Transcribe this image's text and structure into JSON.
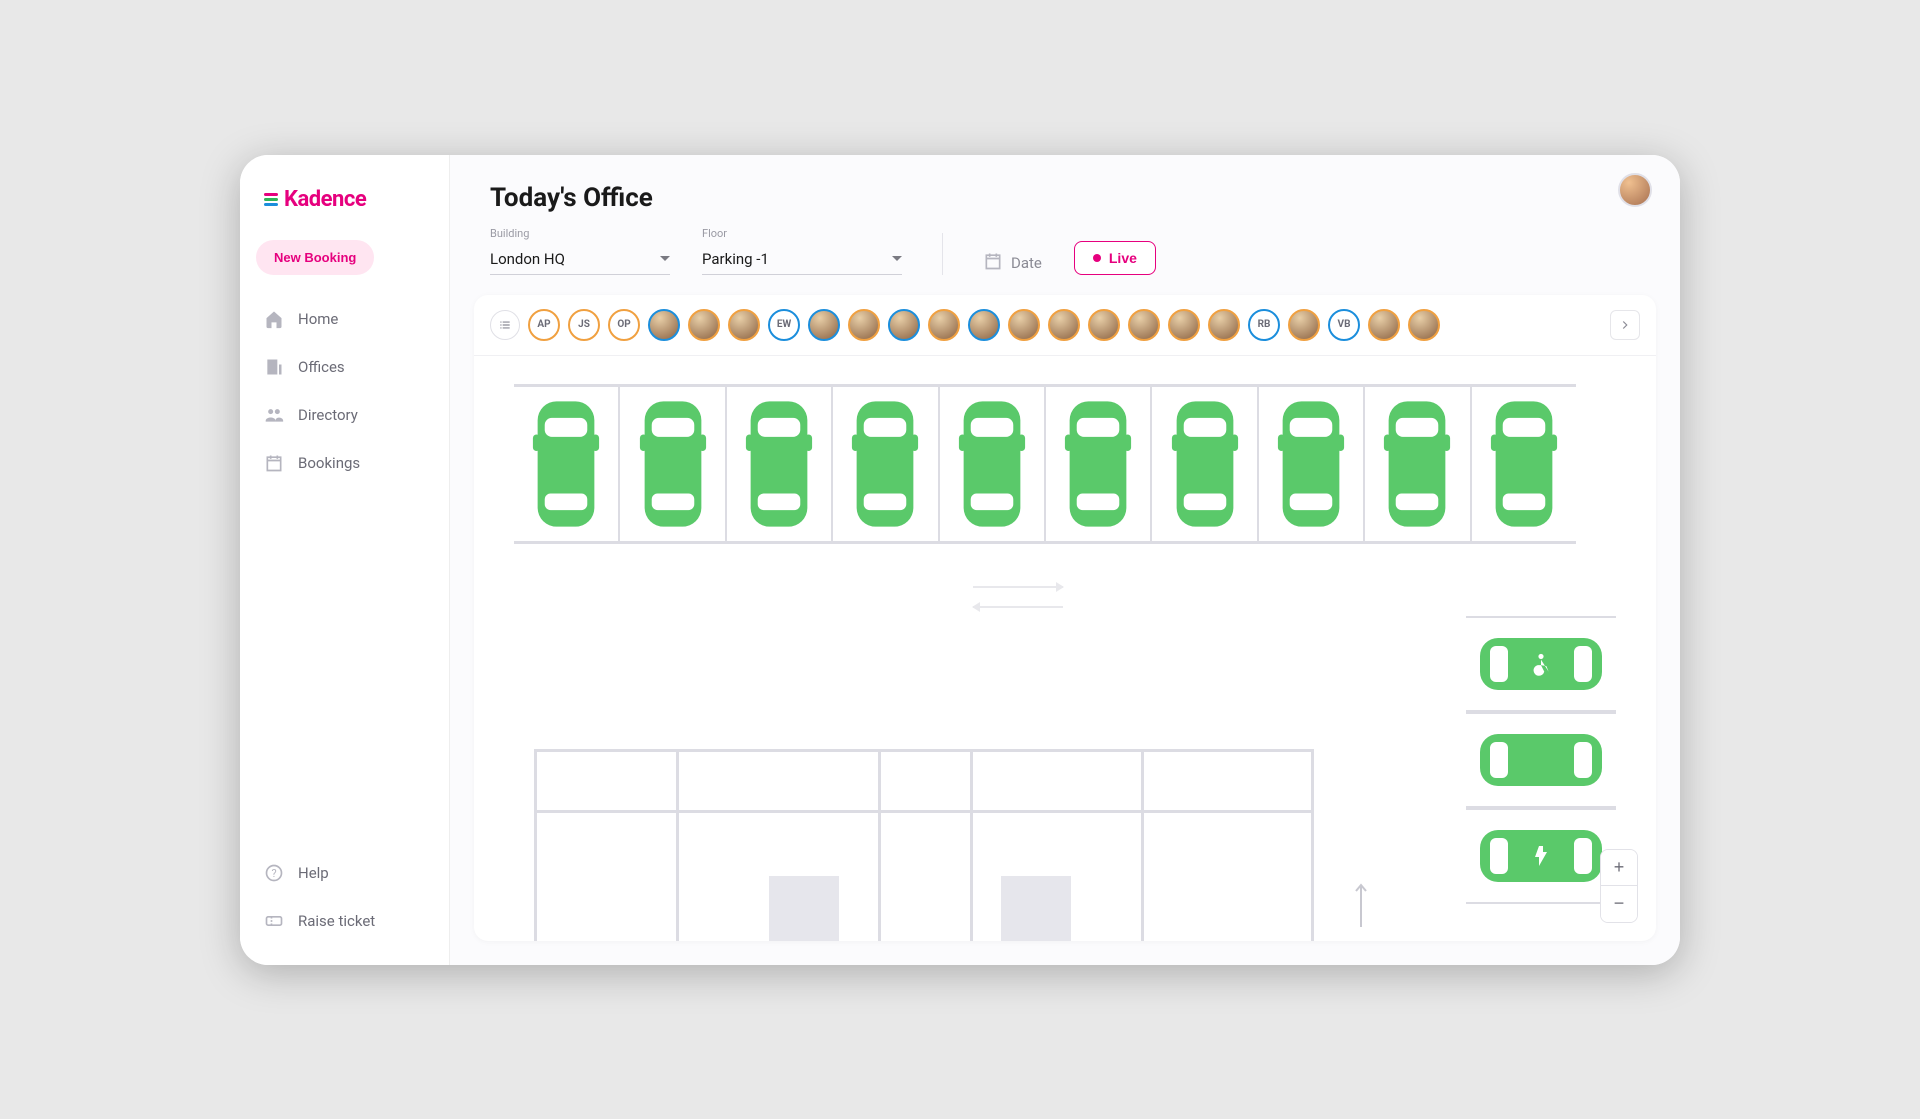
{
  "brand": {
    "name": "Kadence"
  },
  "sidebar": {
    "new_booking_label": "New Booking",
    "items": [
      {
        "label": "Home"
      },
      {
        "label": "Offices"
      },
      {
        "label": "Directory"
      },
      {
        "label": "Bookings"
      }
    ],
    "bottom": [
      {
        "label": "Help"
      },
      {
        "label": "Raise ticket"
      }
    ]
  },
  "header": {
    "title": "Today's Office",
    "building_label": "Building",
    "building_value": "London HQ",
    "floor_label": "Floor",
    "floor_value": "Parking -1",
    "date_label": "Date",
    "live_label": "Live"
  },
  "people_strip": {
    "users": [
      {
        "initials": "AP",
        "ring": "orange",
        "photo": false
      },
      {
        "initials": "JS",
        "ring": "orange",
        "photo": false
      },
      {
        "initials": "OP",
        "ring": "orange",
        "photo": false
      },
      {
        "initials": "",
        "ring": "blue",
        "photo": true
      },
      {
        "initials": "",
        "ring": "orange",
        "photo": true
      },
      {
        "initials": "",
        "ring": "orange",
        "photo": true
      },
      {
        "initials": "EW",
        "ring": "blue",
        "photo": false
      },
      {
        "initials": "",
        "ring": "blue",
        "photo": true
      },
      {
        "initials": "",
        "ring": "orange",
        "photo": true
      },
      {
        "initials": "",
        "ring": "blue",
        "photo": true
      },
      {
        "initials": "",
        "ring": "orange",
        "photo": true
      },
      {
        "initials": "",
        "ring": "blue",
        "photo": true
      },
      {
        "initials": "",
        "ring": "orange",
        "photo": true
      },
      {
        "initials": "",
        "ring": "orange",
        "photo": true
      },
      {
        "initials": "",
        "ring": "orange",
        "photo": true
      },
      {
        "initials": "",
        "ring": "orange",
        "photo": true
      },
      {
        "initials": "",
        "ring": "orange",
        "photo": true
      },
      {
        "initials": "",
        "ring": "orange",
        "photo": true
      },
      {
        "initials": "RB",
        "ring": "blue",
        "photo": false
      },
      {
        "initials": "",
        "ring": "orange",
        "photo": true
      },
      {
        "initials": "VB",
        "ring": "blue",
        "photo": false
      },
      {
        "initials": "",
        "ring": "orange",
        "photo": true
      },
      {
        "initials": "",
        "ring": "orange",
        "photo": true
      }
    ]
  },
  "floorplan": {
    "top_row": [
      {
        "status": "available"
      },
      {
        "status": "available"
      },
      {
        "status": "available"
      },
      {
        "status": "available"
      },
      {
        "status": "available"
      },
      {
        "status": "available"
      },
      {
        "status": "available"
      },
      {
        "status": "available"
      },
      {
        "status": "available"
      },
      {
        "status": "available"
      }
    ],
    "right_column": [
      {
        "status": "available",
        "type": "accessible"
      },
      {
        "status": "available",
        "type": "standard"
      },
      {
        "status": "available",
        "type": "ev"
      }
    ],
    "colors": {
      "available": "#5ac96a"
    }
  },
  "zoom": {
    "in": "+",
    "out": "−"
  }
}
